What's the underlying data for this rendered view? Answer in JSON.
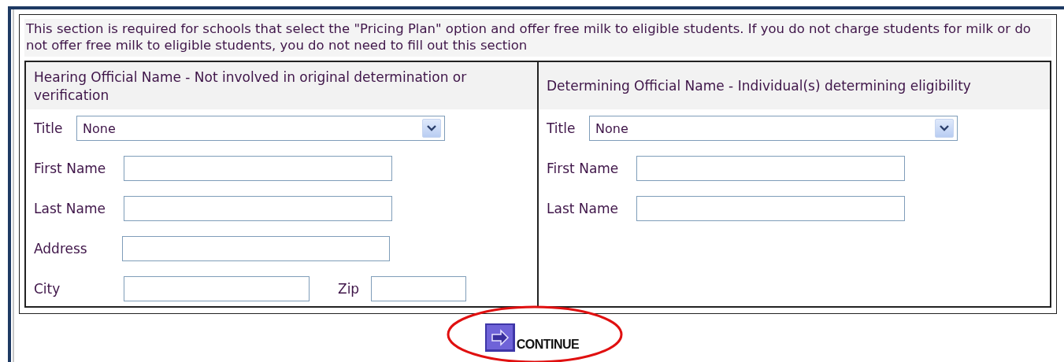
{
  "notice": "This section is required for schools that select the \"Pricing Plan\" option and offer free milk to eligible students. If you do not charge students for milk or do not offer free milk to eligible students, you do not need to fill out this section",
  "sections": [
    {
      "heading": "Hearing Official Name - Not involved in original determination or verification",
      "rows": [
        [
          {
            "kind": "select",
            "label": "Title",
            "value": "None"
          }
        ],
        [
          {
            "kind": "text",
            "label": "First Name"
          }
        ],
        [
          {
            "kind": "text",
            "label": "Last Name"
          }
        ],
        [
          {
            "kind": "text",
            "label": "Address"
          }
        ],
        [
          {
            "kind": "text",
            "label": "City"
          },
          {
            "kind": "text",
            "label": "Zip"
          }
        ]
      ]
    },
    {
      "heading": "Determining Official Name - Individual(s) determining eligibility",
      "rows": [
        [
          {
            "kind": "select",
            "label": "Title",
            "value": "None"
          }
        ],
        [
          {
            "kind": "text",
            "label": "First Name"
          }
        ],
        [
          {
            "kind": "text",
            "label": "Last Name"
          }
        ]
      ]
    }
  ],
  "continue_button": {
    "label": "CONTINUE"
  }
}
